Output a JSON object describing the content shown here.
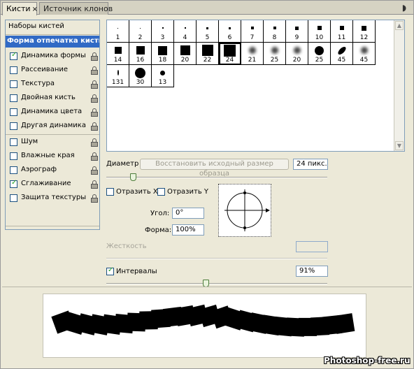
{
  "tabs": [
    {
      "label": "Кисти",
      "close": "×",
      "active": true
    },
    {
      "label": "Источник клонов",
      "active": false
    }
  ],
  "panel_menu_icon": "menu-arrow-icon",
  "left_list": {
    "header": "Наборы кистей",
    "selected": "Форма отпечатка кисти",
    "items": [
      {
        "label": "Динамика формы",
        "checked": true
      },
      {
        "label": "Рассеивание",
        "checked": false
      },
      {
        "label": "Текстура",
        "checked": false
      },
      {
        "label": "Двойная кисть",
        "checked": false
      },
      {
        "label": "Динамика цвета",
        "checked": false
      },
      {
        "label": "Другая динамика",
        "checked": false
      },
      {
        "label": "Шум",
        "checked": false
      },
      {
        "label": "Влажные края",
        "checked": false
      },
      {
        "label": "Аэрограф",
        "checked": false
      },
      {
        "label": "Сглаживание",
        "checked": true
      },
      {
        "label": "Защита текстуры",
        "checked": false
      }
    ]
  },
  "brush_presets": [
    {
      "size": "1",
      "kind": "hard"
    },
    {
      "size": "2",
      "kind": "hard"
    },
    {
      "size": "3",
      "kind": "hard"
    },
    {
      "size": "4",
      "kind": "hard"
    },
    {
      "size": "5",
      "kind": "hard"
    },
    {
      "size": "6",
      "kind": "hard"
    },
    {
      "size": "7",
      "kind": "hard"
    },
    {
      "size": "8",
      "kind": "hard"
    },
    {
      "size": "9",
      "kind": "hard"
    },
    {
      "size": "10",
      "kind": "hard"
    },
    {
      "size": "11",
      "kind": "hard"
    },
    {
      "size": "12",
      "kind": "hard"
    },
    {
      "size": "14",
      "kind": "square"
    },
    {
      "size": "16",
      "kind": "square"
    },
    {
      "size": "18",
      "kind": "square"
    },
    {
      "size": "20",
      "kind": "square"
    },
    {
      "size": "22",
      "kind": "square"
    },
    {
      "size": "24",
      "kind": "square",
      "selected": true
    },
    {
      "size": "21",
      "kind": "soft"
    },
    {
      "size": "25",
      "kind": "soft"
    },
    {
      "size": "20",
      "kind": "soft"
    },
    {
      "size": "25",
      "kind": "round"
    },
    {
      "size": "45",
      "kind": "angled"
    },
    {
      "size": "45",
      "kind": "soft"
    },
    {
      "size": "131",
      "kind": "thin"
    },
    {
      "size": "30",
      "kind": "round"
    },
    {
      "size": "13",
      "kind": "round"
    }
  ],
  "diameter": {
    "label": "Диаметр",
    "restore_label": "Восстановить исходный размер образца",
    "value": "24 пикс.",
    "slider_fraction": 0.12
  },
  "flip_x": {
    "label": "Отразить X",
    "checked": false
  },
  "flip_y": {
    "label": "Отразить Y",
    "checked": false
  },
  "angle": {
    "label": "Угол:",
    "value": "0°"
  },
  "roundness": {
    "label": "Форма:",
    "value": "100%"
  },
  "hardness": {
    "label": "Жесткость",
    "value": ""
  },
  "spacing": {
    "label": "Интервалы",
    "checked": true,
    "value": "91%",
    "slider_fraction": 0.45
  },
  "watermark": "Photoshop-free.ru"
}
